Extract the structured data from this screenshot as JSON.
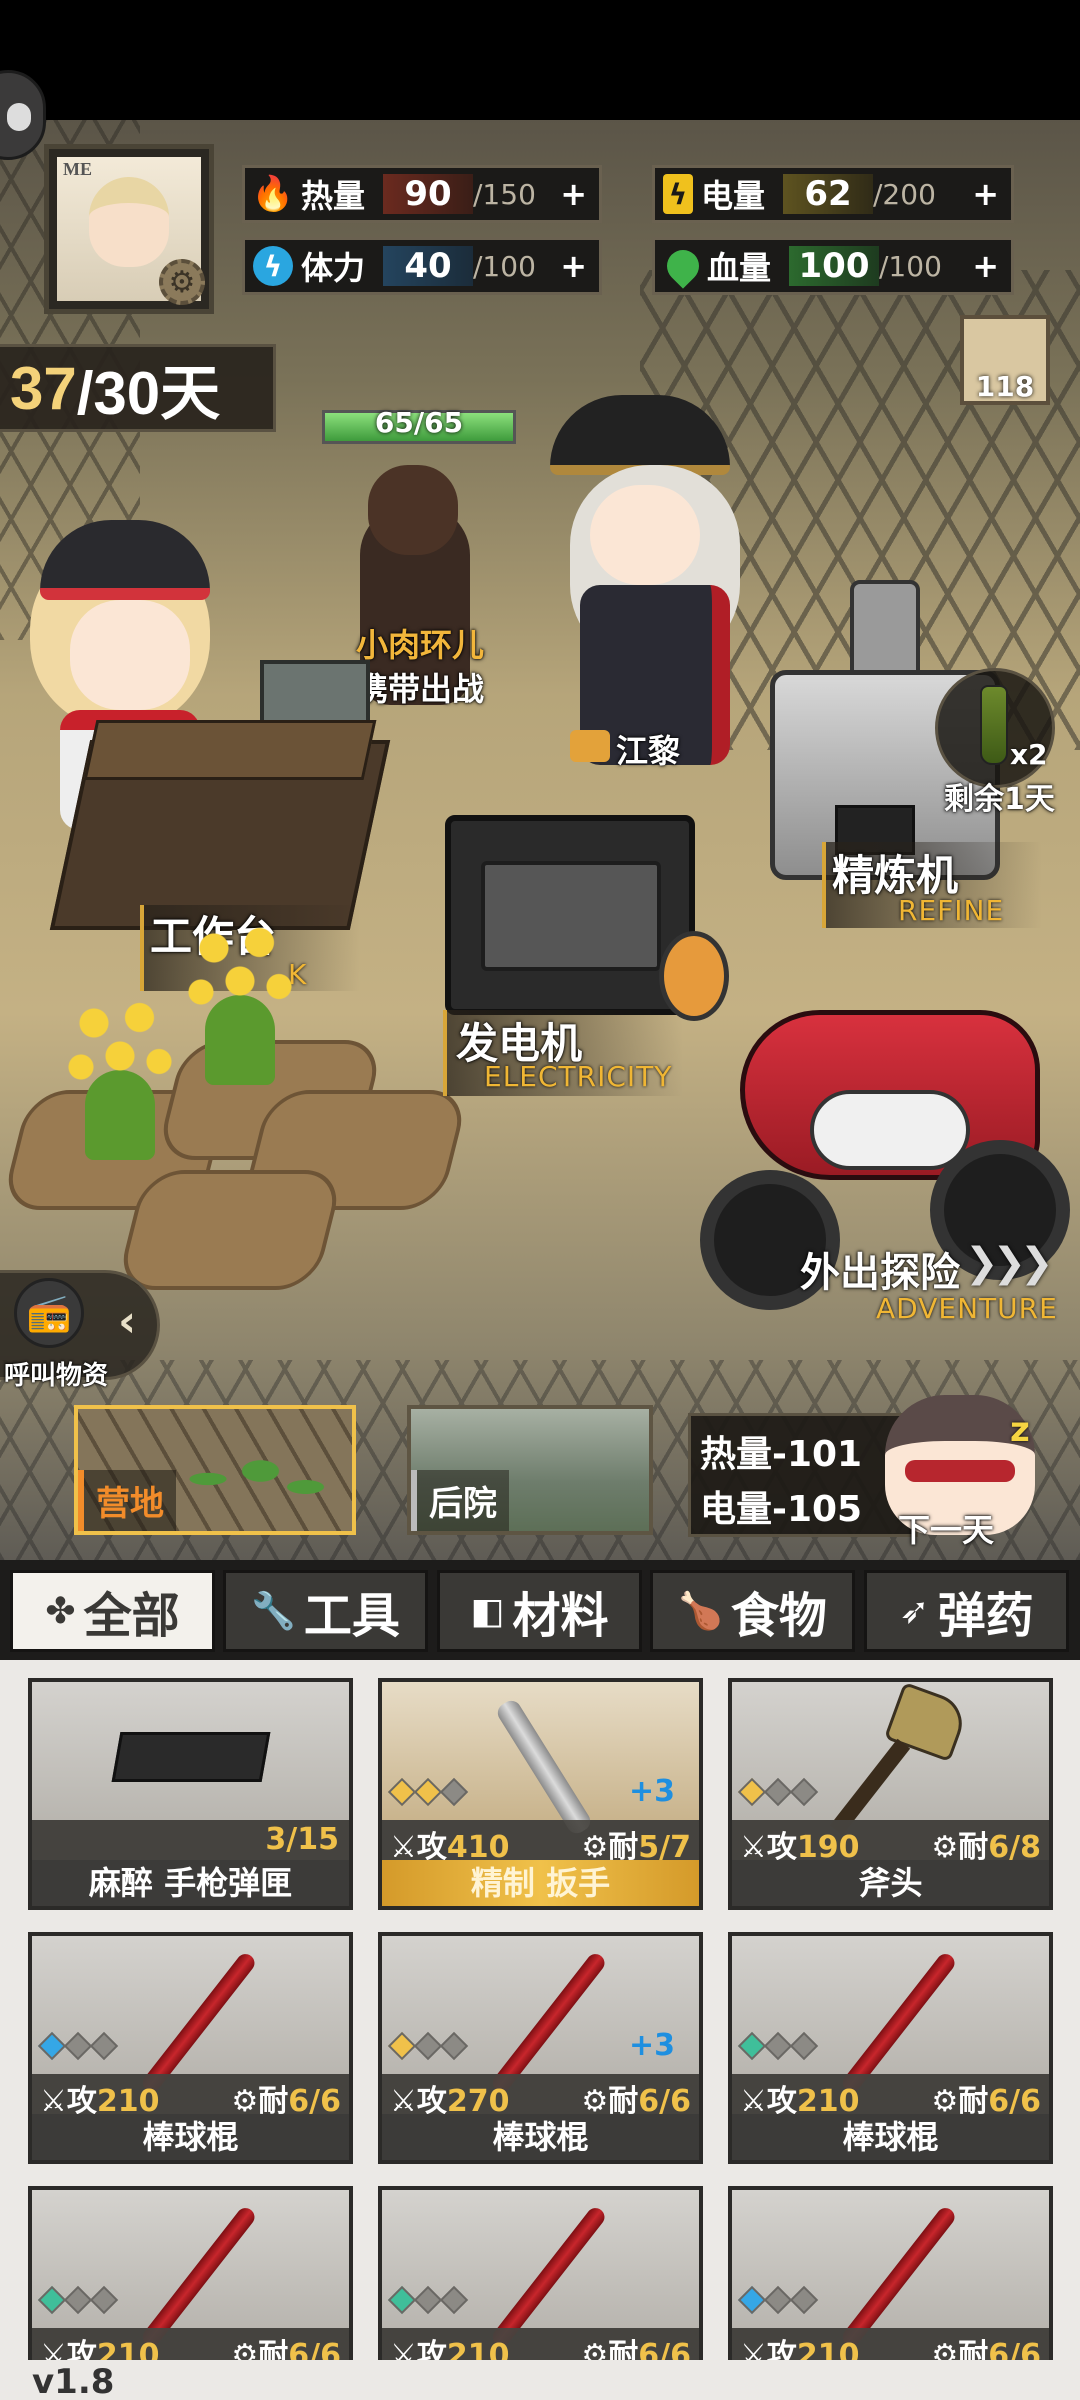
{
  "resources": {
    "heat": {
      "label": "热量",
      "value": "90",
      "max": "/150",
      "plus": "+",
      "color": "#d2333b"
    },
    "stamina": {
      "label": "体力",
      "value": "40",
      "max": "/100",
      "plus": "+",
      "color": "#2aa6e0"
    },
    "power": {
      "label": "电量",
      "value": "62",
      "max": "/200",
      "plus": "+",
      "color": "#f0c11d"
    },
    "blood": {
      "label": "血量",
      "value": "100",
      "max": "/100",
      "plus": "+",
      "color": "#3fb34a"
    }
  },
  "avatar_tag": "ME",
  "days": {
    "current": "37",
    "total": "/30天"
  },
  "mail_count": "118",
  "dog": {
    "hp": "65/65",
    "hp_fraction": 1.0,
    "name": "小肉环儿",
    "status": "携带出战"
  },
  "companion": {
    "name": "江黎"
  },
  "facilities": {
    "workbench": {
      "label": "工作台",
      "sub": "K"
    },
    "generator": {
      "label": "发电机",
      "sub": "ELECTRICITY"
    },
    "refiner": {
      "label": "精炼机",
      "sub": "REFINE",
      "bottle_count": "x2",
      "remaining": "剩余1天"
    },
    "adventure": {
      "label": "外出探险",
      "arrows": "❯❯❯",
      "sub": "ADVENTURE"
    }
  },
  "call_supplies": {
    "label": "呼叫物资",
    "icon": "radio-icon"
  },
  "locations": [
    {
      "label": "营地",
      "active": true
    },
    {
      "label": "后院",
      "active": false
    }
  ],
  "next_day": {
    "heat_cost": "热量-101",
    "power_cost": "电量-105",
    "label": "下一天",
    "z": "z"
  },
  "tabs": [
    {
      "label": "全部",
      "icon": "✤",
      "active": true
    },
    {
      "label": "工具",
      "icon": "🔧",
      "active": false
    },
    {
      "label": "材料",
      "icon": "◧",
      "active": false
    },
    {
      "label": "食物",
      "icon": "🍗",
      "active": false
    },
    {
      "label": "弹药",
      "icon": "➶",
      "active": false
    }
  ],
  "items": [
    {
      "name": "麻醉 手枪弹匣",
      "kind": "ammo",
      "count": "3/15"
    },
    {
      "name": "精制 扳手",
      "kind": "wrench",
      "refined": true,
      "atk_label": "攻",
      "atk": "410",
      "dur_label": "耐",
      "dur": "5/7",
      "plus": "+3",
      "rarity": [
        "#f0c14a",
        "#f0c14a",
        "#8c8a85"
      ]
    },
    {
      "name": "斧头",
      "kind": "axe",
      "atk_label": "攻",
      "atk": "190",
      "dur_label": "耐",
      "dur": "6/8",
      "rarity": [
        "#f0c14a",
        "#8c8a85",
        "#8c8a85"
      ]
    },
    {
      "name": "棒球棍",
      "kind": "bat",
      "atk_label": "攻",
      "atk": "210",
      "dur_label": "耐",
      "dur": "6/6",
      "rarity": [
        "#35a7e6",
        "#8c8a85",
        "#8c8a85"
      ]
    },
    {
      "name": "棒球棍",
      "kind": "bat",
      "atk_label": "攻",
      "atk": "270",
      "dur_label": "耐",
      "dur": "6/6",
      "plus": "+3",
      "rarity": [
        "#f0c14a",
        "#8c8a85",
        "#8c8a85"
      ]
    },
    {
      "name": "棒球棍",
      "kind": "bat",
      "atk_label": "攻",
      "atk": "210",
      "dur_label": "耐",
      "dur": "6/6",
      "rarity": [
        "#3fbf9a",
        "#8c8a85",
        "#8c8a85"
      ]
    },
    {
      "name": "",
      "kind": "bat",
      "atk_label": "攻",
      "atk": "210",
      "dur_label": "耐",
      "dur": "6/6",
      "rarity": [
        "#3fbf9a",
        "#8c8a85",
        "#8c8a85"
      ]
    },
    {
      "name": "",
      "kind": "bat",
      "atk_label": "攻",
      "atk": "210",
      "dur_label": "耐",
      "dur": "6/6",
      "rarity": [
        "#3fbf9a",
        "#8c8a85",
        "#8c8a85"
      ]
    },
    {
      "name": "",
      "kind": "bat",
      "atk_label": "攻",
      "atk": "210",
      "dur_label": "耐",
      "dur": "6/6",
      "rarity": [
        "#35a7e6",
        "#8c8a85",
        "#8c8a85"
      ]
    }
  ],
  "version": "v1.8"
}
